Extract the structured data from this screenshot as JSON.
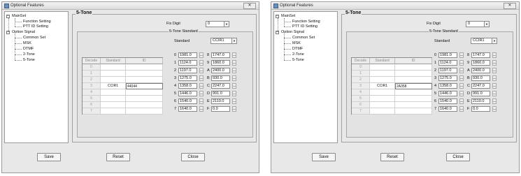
{
  "title": "Optional Features",
  "close_glyph": "✕",
  "tree": {
    "expand_glyph": "−",
    "items": [
      {
        "label": "MainSet"
      },
      {
        "label": "Function Setting"
      },
      {
        "label": "PTT ID Setting"
      },
      {
        "label": "Option Signal"
      },
      {
        "label": "Common Set"
      },
      {
        "label": "MSK"
      },
      {
        "label": "DTMF"
      },
      {
        "label": "2-Tone"
      },
      {
        "label": "5-Tone"
      }
    ]
  },
  "panel_title": "5-Tone",
  "fix_digit": {
    "label": "Fix Digit",
    "value": "0"
  },
  "group_label": "5-Tone Standard",
  "standard": {
    "label": "Standard",
    "value": "CCIR1"
  },
  "table": {
    "headers": [
      "Decode",
      "Standard",
      "ID"
    ],
    "rows": [
      {
        "decode": "0",
        "standard": "",
        "id": ""
      },
      {
        "decode": "1",
        "standard": "",
        "id": ""
      },
      {
        "decode": "2",
        "standard": "",
        "id": ""
      },
      {
        "decode": "3",
        "standard": "CCIR1",
        "id": ""
      },
      {
        "decode": "4",
        "standard": "",
        "id": ""
      },
      {
        "decode": "5",
        "standard": "",
        "id": ""
      },
      {
        "decode": "6",
        "standard": "",
        "id": ""
      },
      {
        "decode": "7",
        "standard": "",
        "id": ""
      }
    ]
  },
  "freqs_left": [
    {
      "key": "0",
      "value": "1981.0"
    },
    {
      "key": "1",
      "value": "1124.0"
    },
    {
      "key": "2",
      "value": "1197.0"
    },
    {
      "key": "3",
      "value": "1275.0"
    },
    {
      "key": "4",
      "value": "1358.0"
    },
    {
      "key": "5",
      "value": "1446.0"
    },
    {
      "key": "6",
      "value": "1540.0"
    },
    {
      "key": "7",
      "value": "1640.0"
    }
  ],
  "freqs_right": [
    {
      "key": "8",
      "value": "1747.0"
    },
    {
      "key": "9",
      "value": "1860.0"
    },
    {
      "key": "A",
      "value": "2400.0"
    },
    {
      "key": "B",
      "value": "930.0"
    },
    {
      "key": "C",
      "value": "2247.0"
    },
    {
      "key": "D",
      "value": "991.0"
    },
    {
      "key": "E",
      "value": "2110.0"
    },
    {
      "key": "F",
      "value": "0.0"
    }
  ],
  "buttons": {
    "save": "Save",
    "reset": "Reset",
    "close": "Close"
  },
  "ids": {
    "left": "44044",
    "right": "2A358"
  }
}
